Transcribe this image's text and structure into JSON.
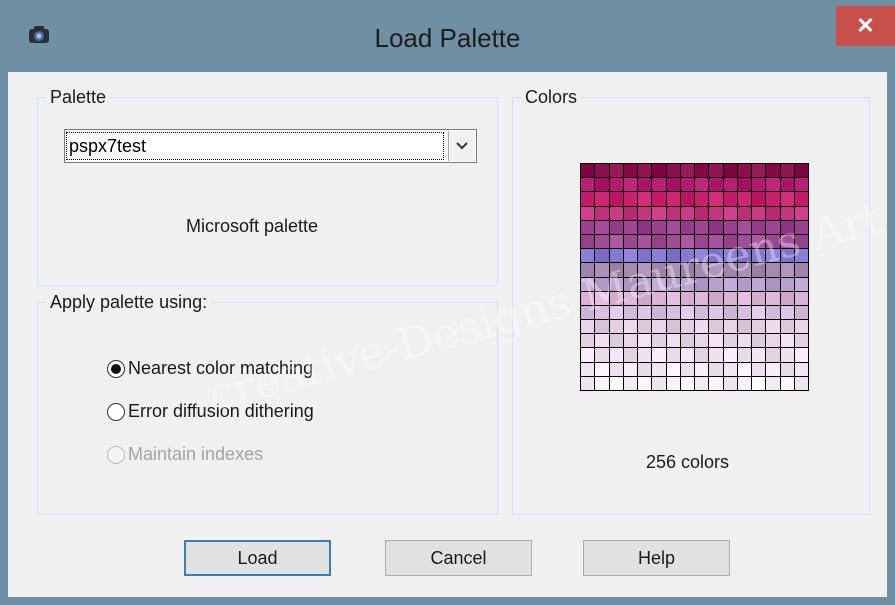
{
  "window": {
    "title": "Load Palette",
    "close_label": "✕"
  },
  "palette_group": {
    "label": "Palette",
    "selected": "pspx7test",
    "description": "Microsoft palette"
  },
  "apply_group": {
    "label": "Apply palette using:",
    "options": [
      {
        "label": "Nearest color matching",
        "checked": true,
        "enabled": true
      },
      {
        "label": "Error diffusion dithering",
        "checked": false,
        "enabled": true
      },
      {
        "label": "Maintain indexes",
        "checked": false,
        "enabled": false
      }
    ]
  },
  "colors_group": {
    "label": "Colors",
    "count_text": "256 colors",
    "row_colors": [
      "#8b0f4d",
      "#b21a6f",
      "#c8206e",
      "#c4357f",
      "#9b3f8f",
      "#a24c98",
      "#8678ce",
      "#a58bb1",
      "#b9a0cc",
      "#d9b2d6",
      "#d9c0e0",
      "#e2cde3",
      "#e9d7e9",
      "#ece1ec",
      "#f1e9f2",
      "#f8f3f8"
    ]
  },
  "buttons": {
    "load": "Load",
    "cancel": "Cancel",
    "help": "Help"
  },
  "watermark": "creative-Designs Maureens Art"
}
